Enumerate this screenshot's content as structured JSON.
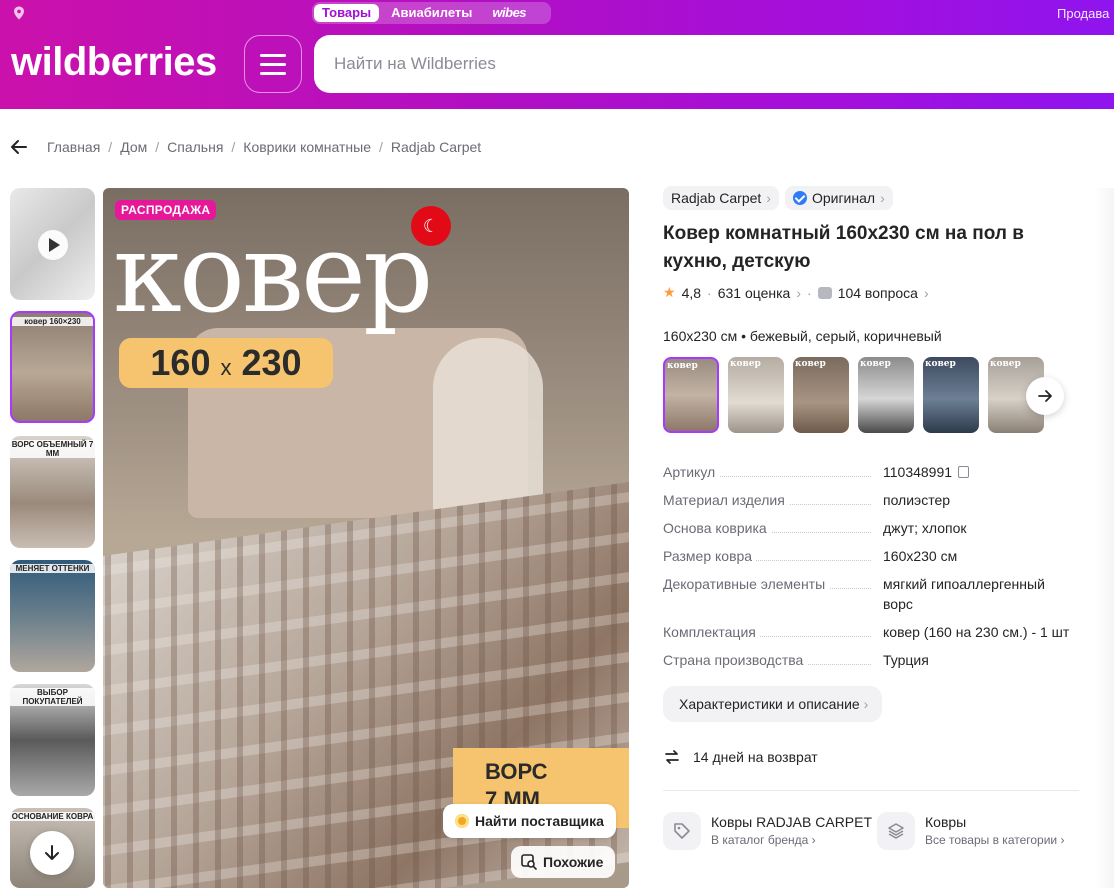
{
  "header": {
    "tabs": [
      {
        "label": "Товары",
        "active": true
      },
      {
        "label": "Авиабилеты",
        "active": false
      },
      {
        "label": "wibes",
        "active": false
      }
    ],
    "sell_label": "Продава",
    "logo_text": "wildberries",
    "search_placeholder": "Найти на Wildberries",
    "accent_gradient": [
      "#cb11ab",
      "#8f14ee"
    ]
  },
  "breadcrumbs": [
    "Главная",
    "Дом",
    "Спальня",
    "Коврики комнатные",
    "Radjab Carpet"
  ],
  "gallery": {
    "thumbnails": [
      {
        "label": "",
        "video": true
      },
      {
        "label": "ковер 160×230",
        "selected": true
      },
      {
        "label": "ВОРС ОБЪЕМНЫЙ 7 ММ"
      },
      {
        "label": "МЕНЯЕТ ОТТЕНКИ"
      },
      {
        "label": "ВЫБОР ПОКУПАТЕЛЕЙ"
      },
      {
        "label": "ОСНОВАНИЕ КОВРА"
      }
    ],
    "main": {
      "sale_badge": "РАСПРОДАЖА",
      "headline": "ковер",
      "flag_symbol": "☾",
      "size_a": "160",
      "size_x": "x",
      "size_b": "230",
      "pile_line1": "ВОРС",
      "pile_line2": "7 ММ",
      "find_supplier": "Найти поставщика",
      "similar": "Похожие"
    }
  },
  "product": {
    "brand": "Radjab Carpet",
    "original": "Оригинал",
    "title": "Ковер комнатный 160х230 см на пол в кухню, детскую",
    "rating": "4,8",
    "reviews": "631 оценка",
    "questions": "104 вопроса",
    "variant_text": "160х230 см • бежевый, серый, коричневый",
    "variant_count": 6,
    "specs": [
      {
        "key": "Артикул",
        "value": "110348991"
      },
      {
        "key": "Материал изделия",
        "value": "полиэстер"
      },
      {
        "key": "Основа коврика",
        "value": "джут; хлопок"
      },
      {
        "key": "Размер ковра",
        "value": "160х230 см"
      },
      {
        "key": "Декоративные элементы",
        "value": "мягкий гипоаллергенный ворс"
      },
      {
        "key": "Комплектация",
        "value": "ковер (160 на 230 см.) - 1 шт"
      },
      {
        "key": "Страна производства",
        "value": "Турция"
      }
    ],
    "details_button": "Характеристики и описание",
    "return_text": "14 дней на возврат",
    "brand_catalog": {
      "title": "Ковры RADJAB CARPET",
      "link": "В каталог бренда"
    },
    "category": {
      "title": "Ковры",
      "link": "Все товары в категории"
    }
  }
}
